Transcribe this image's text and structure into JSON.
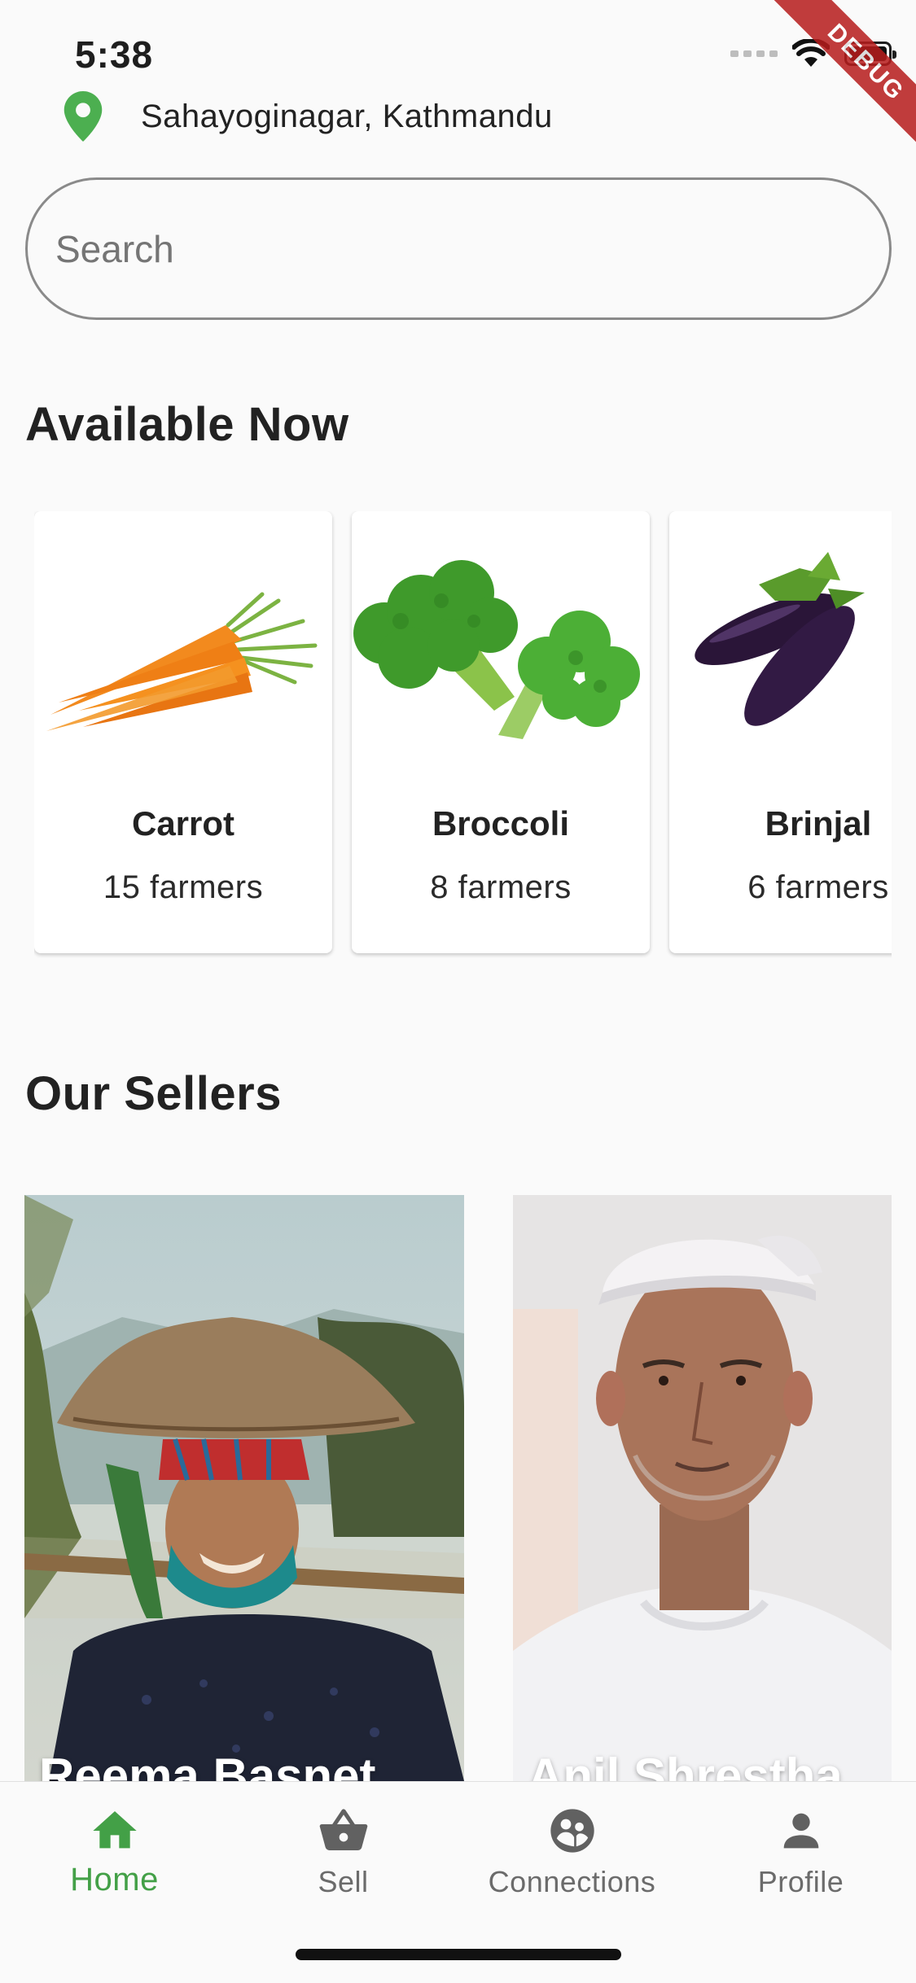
{
  "status_bar": {
    "time": "5:38"
  },
  "debug_banner": "DEBUG",
  "location": {
    "label": "Sahayoginagar, Kathmandu",
    "icon": "map-pin-icon",
    "color": "#4caf50"
  },
  "search": {
    "placeholder": "Search"
  },
  "available": {
    "title": "Available Now",
    "items": [
      {
        "name": "Carrot",
        "farmers": "15 farmers",
        "image": "carrot-image"
      },
      {
        "name": "Broccoli",
        "farmers": "8 farmers",
        "image": "broccoli-image"
      },
      {
        "name": "Brinjal",
        "farmers": "6 farmers",
        "image": "brinjal-image"
      }
    ]
  },
  "sellers": {
    "title": "Our Sellers",
    "items": [
      {
        "name": "Reema Basnet",
        "image": "seller-photo"
      },
      {
        "name": "Anil Shrestha",
        "image": "seller-photo"
      }
    ]
  },
  "bottom_nav": {
    "active_color": "#43a047",
    "inactive_color": "#6b6b6b",
    "items": [
      {
        "label": "Home",
        "icon": "home-icon",
        "active": true
      },
      {
        "label": "Sell",
        "icon": "basket-icon",
        "active": false
      },
      {
        "label": "Connections",
        "icon": "connections-icon",
        "active": false
      },
      {
        "label": "Profile",
        "icon": "person-icon",
        "active": false
      }
    ]
  }
}
